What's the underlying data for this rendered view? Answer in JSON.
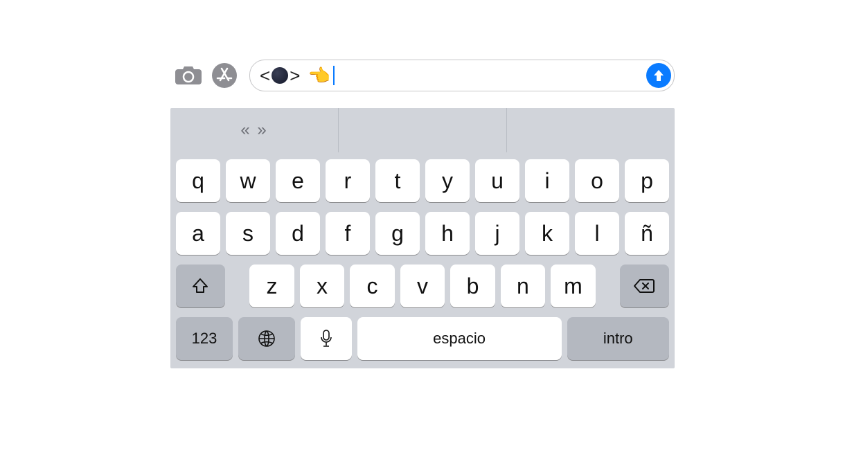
{
  "compose": {
    "lt": "<",
    "gt": ">",
    "emoji_point": "👈",
    "send_icon": "arrow-up"
  },
  "suggestions": {
    "slot1": "« »",
    "slot2": "",
    "slot3": ""
  },
  "keys": {
    "row1": [
      "q",
      "w",
      "e",
      "r",
      "t",
      "y",
      "u",
      "i",
      "o",
      "p"
    ],
    "row2": [
      "a",
      "s",
      "d",
      "f",
      "g",
      "h",
      "j",
      "k",
      "l",
      "ñ"
    ],
    "row3": [
      "z",
      "x",
      "c",
      "v",
      "b",
      "n",
      "m"
    ],
    "numbers": "123",
    "space": "espacio",
    "enter": "intro"
  }
}
